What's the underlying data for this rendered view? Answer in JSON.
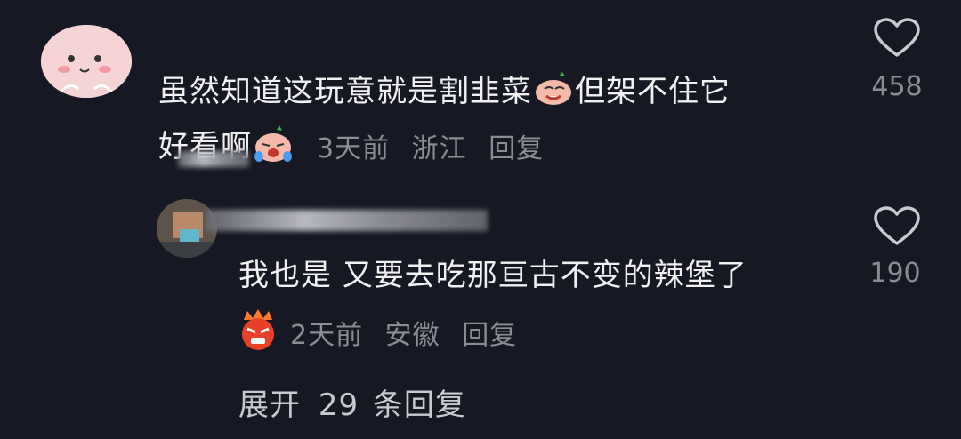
{
  "comment1": {
    "text_line1": "虽然知道这玩意就是割韭菜",
    "text_after_emoji": "但架不住它",
    "text_line2": "好看啊",
    "time": "3天前",
    "location": "浙江",
    "reply_label": "回复",
    "likes": "458"
  },
  "comment2": {
    "text": "我也是 又要去吃那亘古不变的辣堡了",
    "time": "2天前",
    "location": "安徽",
    "reply_label": "回复",
    "likes": "190"
  },
  "expand": {
    "prefix": "展开",
    "count": "29",
    "suffix": "条回复"
  },
  "icons": {
    "heart": "heart-outline-icon",
    "emoji_leek": "leek-emoji-icon",
    "emoji_cry": "crying-emoji-icon",
    "emoji_angry": "angry-emoji-icon"
  },
  "colors": {
    "background": "#161823",
    "text": "#f1f1f3",
    "meta": "#8b8c94"
  }
}
